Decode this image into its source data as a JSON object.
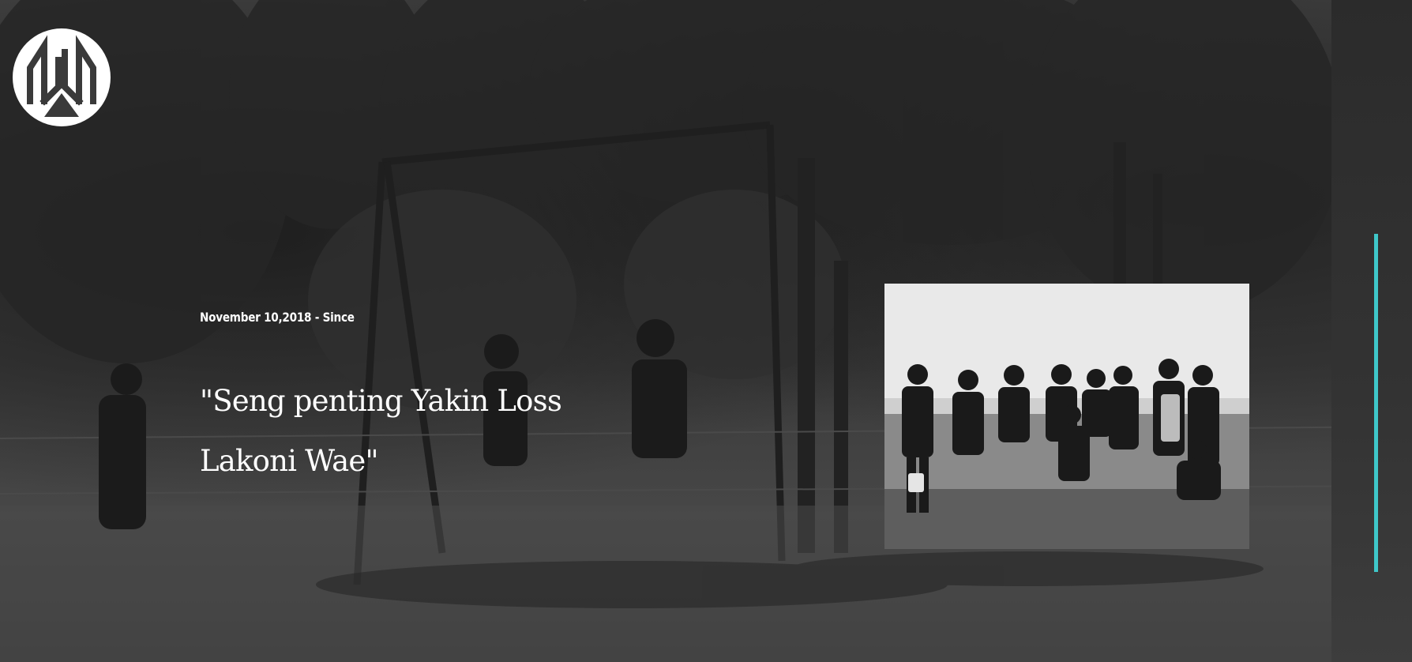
{
  "hero": {
    "date_text": "November 10,2018 - Since",
    "quote_line1": "\"Seng penting Yakin Loss",
    "quote_line2": "Lakoni Wae\""
  },
  "logo": {
    "icon": "brand-monogram-icon"
  },
  "photo": {
    "kind": "group-photo"
  },
  "colors": {
    "accent": "#3fc7c9",
    "text": "#ffffff",
    "background": "#3a3a3a"
  }
}
